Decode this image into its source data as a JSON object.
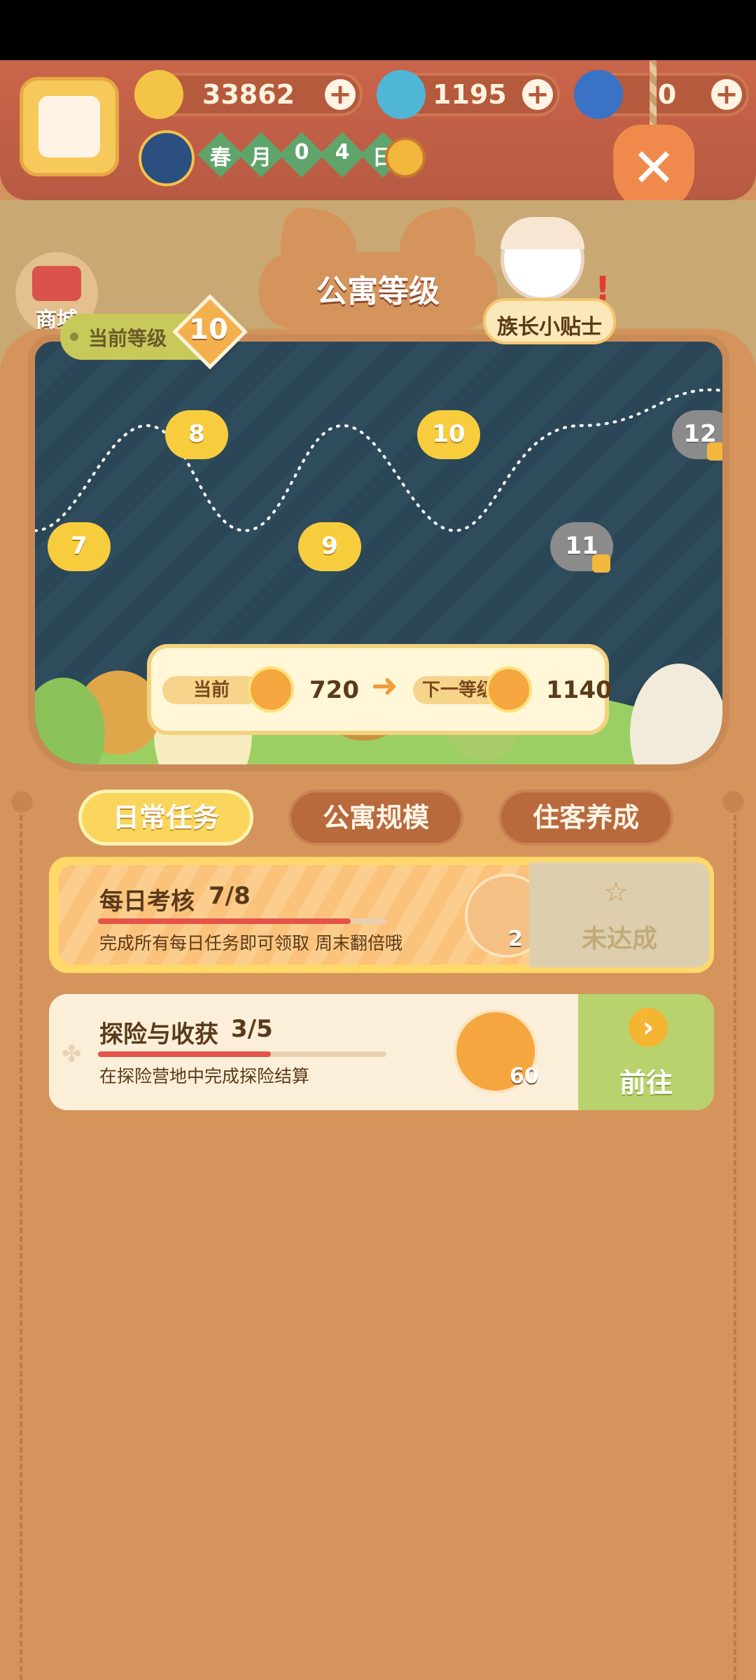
{
  "resources": {
    "banana": "33862",
    "fire": "1195",
    "feather": "0"
  },
  "season": [
    "春",
    "月",
    "0",
    "4",
    "日"
  ],
  "side": {
    "shop_label": "商城"
  },
  "panel": {
    "title": "公寓等级",
    "current_level_label": "当前等级",
    "current_level": "10",
    "tips_label": "族长小贴士"
  },
  "map": {
    "nodes": [
      {
        "label": "7",
        "locked": false
      },
      {
        "label": "8",
        "locked": false
      },
      {
        "label": "9",
        "locked": false
      },
      {
        "label": "10",
        "locked": false
      },
      {
        "label": "11",
        "locked": true
      },
      {
        "label": "12",
        "locked": true
      }
    ]
  },
  "level_card": {
    "current_label": "当前",
    "current_value": "720",
    "next_label": "下一等级",
    "next_value": "1140"
  },
  "tabs": [
    "日常任务",
    "公寓规模",
    "住客养成"
  ],
  "tasks": [
    {
      "title": "每日考核",
      "progress": "7/8",
      "progress_fraction": 0.875,
      "desc": "完成所有每日任务即可领取 周末翻倍哦",
      "reward_amount": "2",
      "status": "未达成"
    },
    {
      "title": "探险与收获",
      "progress": "3/5",
      "progress_fraction": 0.6,
      "desc": "在探险营地中完成探险结算",
      "reward_amount": "60",
      "action": "前往"
    }
  ],
  "colors": {
    "accent": "#f9d65b",
    "panel": "#d4945c",
    "progress": "#e4544a",
    "go": "#b8d36d"
  }
}
